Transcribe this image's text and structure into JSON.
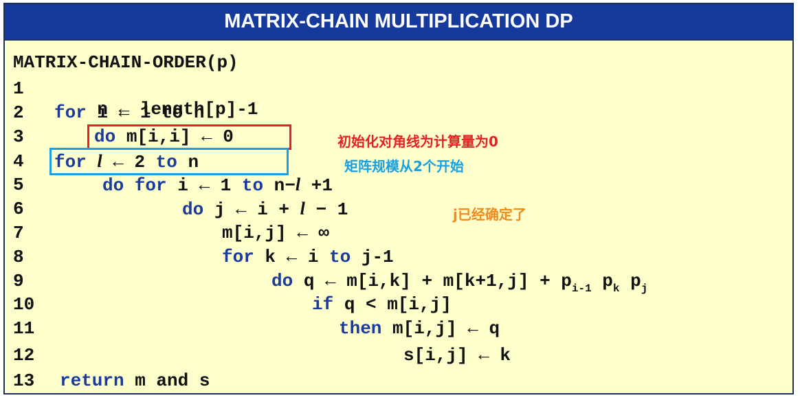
{
  "title": "MATRIX-CHAIN MULTIPLICATION DP",
  "heading": "MATRIX-CHAIN-ORDER(p)",
  "lines": {
    "n1": "1",
    "n2": "2",
    "n3": "3",
    "n4": "4",
    "n5": "5",
    "n6": "6",
    "n7": "7",
    "n8": "8",
    "n9": "9",
    "n10": "10",
    "n11": "11",
    "n12": "12",
    "n13": "13",
    "l1_text": "n ← length[p]-1",
    "l2_kw": "for",
    "l2_text": " i ← 1 to n",
    "l3_kw": "do",
    "l3_text": " m[i,i] ← 0",
    "l4_kw1": "for",
    "l4_var": "l",
    "l4_text1": " ← 2 ",
    "l4_kw2": "to",
    "l4_text2": " n",
    "l5_kw1": "do",
    "l5_kw2": "for",
    "l5_text1": " i ← 1 ",
    "l5_kw3": "to",
    "l5_text2": " n−",
    "l5_var": "l",
    "l5_text3": " +1",
    "l6_kw": "do",
    "l6_text1": " j ← i + ",
    "l6_var": "l",
    "l6_text2": " − 1",
    "l7_text": "m[i,j] ← ∞",
    "l8_kw1": "for",
    "l8_text1": " k ← i ",
    "l8_kw2": "to",
    "l8_text2": " j-1",
    "l9_kw": "do",
    "l9_text": " q ← m[i,k] + m[k+1,j] + p",
    "l9_sub1": "i-1",
    "l9_p2": " p",
    "l9_sub2": "k",
    "l9_p3": " p",
    "l9_sub3": "j",
    "l10_kw": "if",
    "l10_text": " q < m[i,j]",
    "l11_kw": "then",
    "l11_text": " m[i,j] ← q",
    "l12_text": "s[i,j] ← k",
    "l13_kw": "return",
    "l13_text": " m and s"
  },
  "annotations": {
    "note1": "初始化对角线为计算量为0",
    "note2": "矩阵规模从2个开始",
    "note3": "j已经确定了"
  },
  "colors": {
    "title_bg": "#163a9b",
    "background": "#ffffcc",
    "keyword": "#1a3a9c",
    "red_note": "#e52222",
    "blue_note": "#1aa0e0",
    "orange_note": "#f08a1c"
  }
}
